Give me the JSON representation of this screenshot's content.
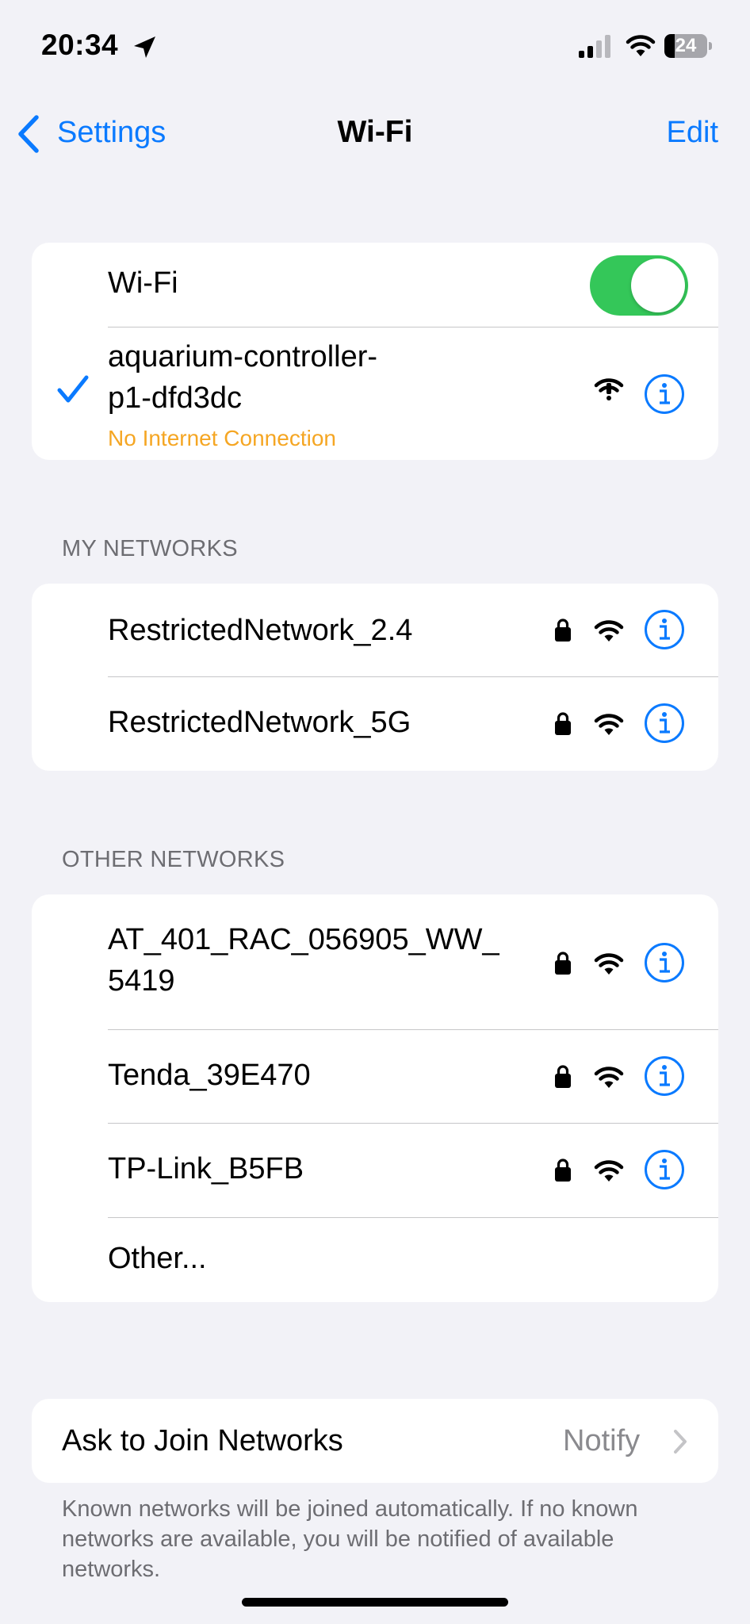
{
  "status_bar": {
    "time": "20:34",
    "battery_percent": "24",
    "battery_level": 0.24
  },
  "nav": {
    "back_label": "Settings",
    "title": "Wi-Fi",
    "edit_label": "Edit"
  },
  "wifi_toggle": {
    "label": "Wi-Fi",
    "on": true
  },
  "connected_network": {
    "name_line1": "aquarium-controller-",
    "name_line2": "p1-dfd3dc",
    "status": "No Internet Connection"
  },
  "my_networks": {
    "header": "MY NETWORKS",
    "items": [
      {
        "name": "RestrictedNetwork_2.4",
        "locked": true
      },
      {
        "name": "RestrictedNetwork_5G",
        "locked": true
      }
    ]
  },
  "other_networks": {
    "header": "OTHER NETWORKS",
    "items": [
      {
        "name_line1": "AT_401_RAC_056905_WW_",
        "name_line2": "5419",
        "locked": true
      },
      {
        "name": "Tenda_39E470",
        "locked": true
      },
      {
        "name": "TP-Link_B5FB",
        "locked": true
      }
    ],
    "other_label": "Other..."
  },
  "ask_to_join": {
    "label": "Ask to Join Networks",
    "value": "Notify"
  },
  "footer_note": "Known networks will be joined automatically. If no known networks are available, you will be notified of available networks.",
  "colors": {
    "accent": "#0a7aff",
    "toggle_on": "#34c759",
    "warning": "#f5a623",
    "background": "#f2f2f7"
  }
}
